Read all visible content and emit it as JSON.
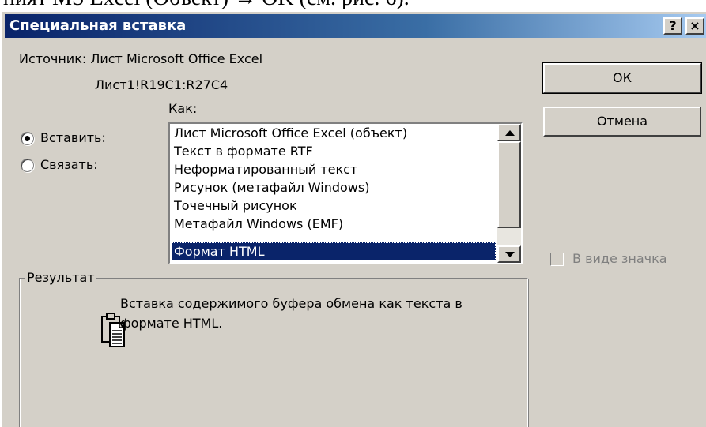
{
  "doc_fragment": "ният MS Excel (Объект) → OK (см. рис. 6).",
  "title": "Специальная вставка",
  "titlebar_buttons": {
    "help": "?",
    "close": "×"
  },
  "source": {
    "label": "Источник: Лист Microsoft Office Excel",
    "range": "Лист1!R19C1:R27C4"
  },
  "as_label": "Как:",
  "radio": {
    "paste": "Вставить:",
    "link": "Связать:",
    "selected": "paste"
  },
  "list_items": [
    "Лист Microsoft Office Excel (объект)",
    "Текст в формате RTF",
    "Неформатированный текст",
    "Рисунок (метафайл Windows)",
    "Точечный рисунок",
    "Метафайл Windows (EMF)",
    "Формат HTML"
  ],
  "selected_item_index": 6,
  "buttons": {
    "ok": "ОК",
    "cancel": "Отмена"
  },
  "icon_checkbox": {
    "label": "В виде значка",
    "checked": false,
    "enabled": false
  },
  "result": {
    "title": "Результат",
    "line1": "Вставка содержимого буфера обмена как текста в",
    "line2": "формате HTML."
  },
  "colors": {
    "title_bar": "#0a246a",
    "selection": "#0a246a",
    "dialog_bg": "#d4d0c8",
    "disabled_text": "#808080"
  }
}
